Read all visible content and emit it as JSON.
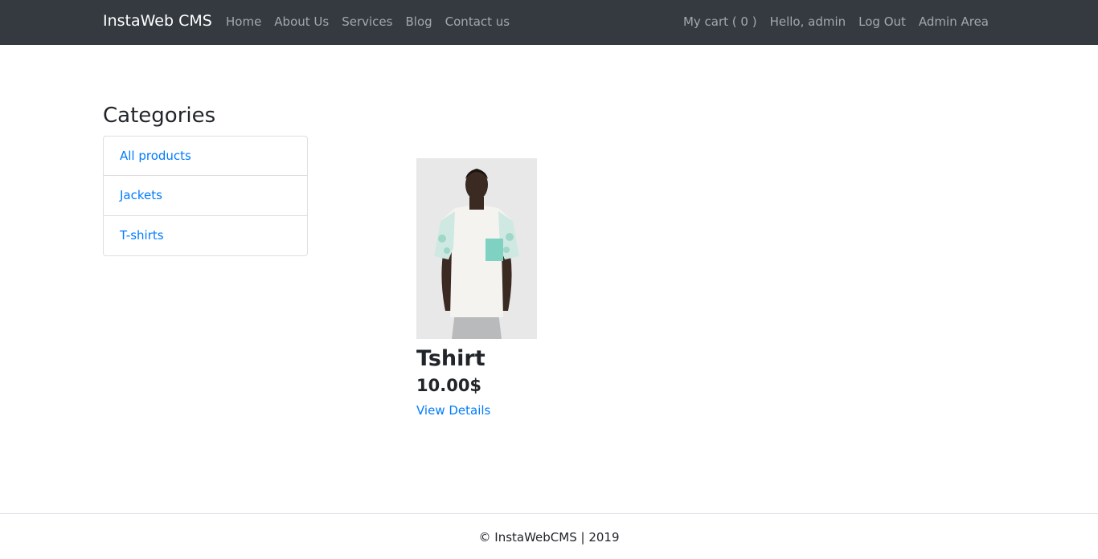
{
  "navbar": {
    "brand": "InstaWeb CMS",
    "left_links": [
      "Home",
      "About Us",
      "Services",
      "Blog",
      "Contact us"
    ],
    "right_links": [
      "My cart ( 0 )",
      "Hello, admin",
      "Log Out",
      "Admin Area"
    ]
  },
  "sidebar": {
    "title": "Categories",
    "items": [
      {
        "label": "All products"
      },
      {
        "label": "Jackets"
      },
      {
        "label": "T-shirts"
      }
    ]
  },
  "product": {
    "name": "Tshirt",
    "price": "10.00$",
    "link": "View Details",
    "image_icon": "product-photo-tshirt"
  },
  "footer": {
    "text": "© InstaWebCMS | 2019"
  },
  "colors": {
    "navbar_bg": "#343a40",
    "link": "#007bff",
    "text": "#212529"
  }
}
